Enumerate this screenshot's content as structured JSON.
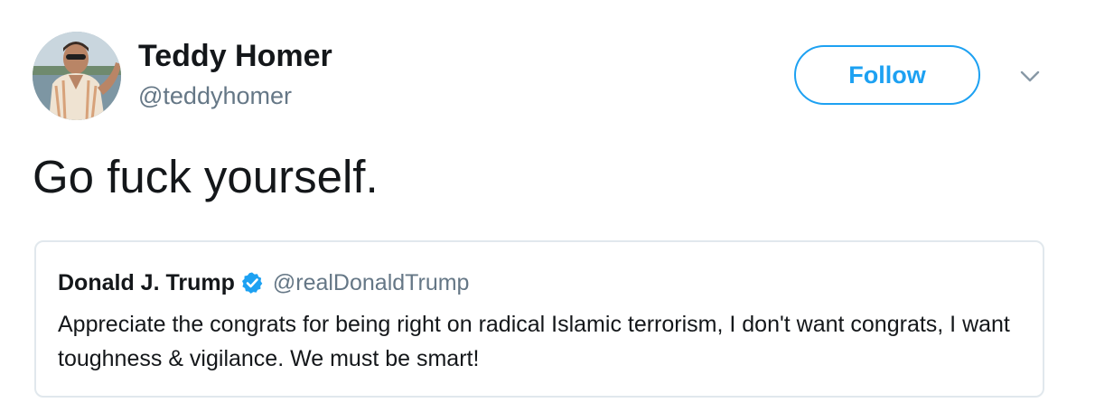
{
  "author": {
    "name": "Teddy Homer",
    "handle": "@teddyhomer",
    "avatar_icon": "user-avatar-photo"
  },
  "actions": {
    "follow_label": "Follow",
    "menu_icon": "chevron-down-icon"
  },
  "tweet": {
    "text": "Go fuck yourself."
  },
  "quoted_tweet": {
    "author_name": "Donald J. Trump",
    "verified_icon": "verified-badge-icon",
    "author_handle": "@realDonaldTrump",
    "text": "Appreciate the congrats for being right on radical Islamic terrorism, I don't want congrats, I want toughness & vigilance. We must be smart!"
  },
  "colors": {
    "accent": "#1da1f2",
    "text_primary": "#14171a",
    "text_secondary": "#657786",
    "border": "#e1e8ed"
  }
}
